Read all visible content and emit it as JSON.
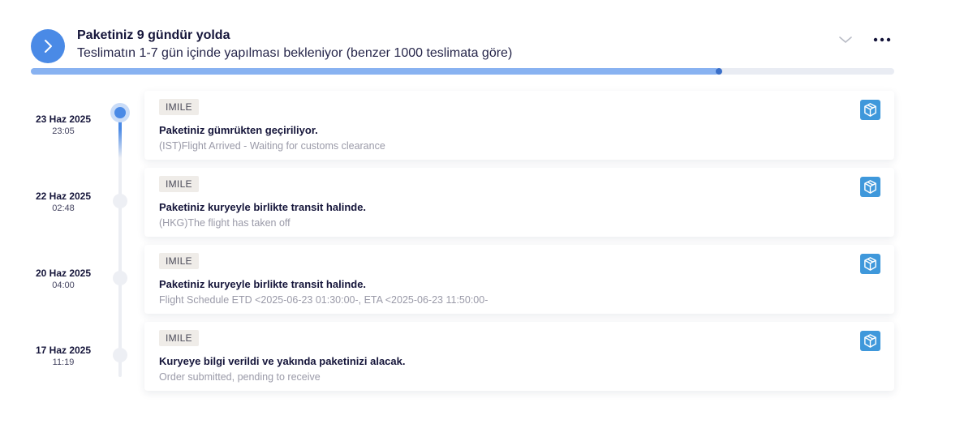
{
  "header": {
    "title": "Paketiniz 9 gündür yolda",
    "subtitle": "Teslimatın 1-7 gün içinde yapılması bekleniyor (benzer 1000 teslimata göre)",
    "progress_fraction": 0.797
  },
  "colors": {
    "accent": "#4a8ae6",
    "progress_fill": "#88b2f1",
    "box_icon": "#3f98db",
    "tag_bg": "#efece8"
  },
  "events": [
    {
      "date": "23 Haz 2025",
      "time": "23:05",
      "carrier": "IMILE",
      "title": "Paketiniz gümrükten geçiriliyor.",
      "detail": "(IST)Flight Arrived - Waiting for customs clearance",
      "active": true,
      "icon": "package-box-icon"
    },
    {
      "date": "22 Haz 2025",
      "time": "02:48",
      "carrier": "IMILE",
      "title": "Paketiniz kuryeyle birlikte transit halinde.",
      "detail": "(HKG)The flight has taken off",
      "active": false,
      "icon": "package-box-icon"
    },
    {
      "date": "20 Haz 2025",
      "time": "04:00",
      "carrier": "IMILE",
      "title": "Paketiniz kuryeyle birlikte transit halinde.",
      "detail": "Flight Schedule ETD <2025-06-23 01:30:00-, ETA <2025-06-23 11:50:00-",
      "active": false,
      "icon": "package-box-icon"
    },
    {
      "date": "17 Haz 2025",
      "time": "11:19",
      "carrier": "IMILE",
      "title": "Kuryeye bilgi verildi ve yakında paketinizi alacak.",
      "detail": "Order submitted, pending to receive",
      "active": false,
      "icon": "package-box-icon"
    }
  ]
}
